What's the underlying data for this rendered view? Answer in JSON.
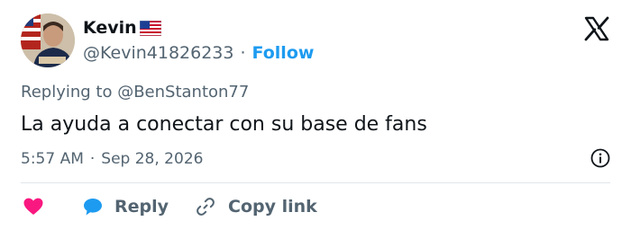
{
  "author": {
    "name": "Kevin",
    "flag_icon": "us-flag-icon",
    "handle": "@Kevin41826233",
    "separator": "·",
    "follow_label": "Follow"
  },
  "reply": {
    "replying_to": "Replying to @BenStanton77"
  },
  "tweet": {
    "text": "La ayuda a conectar con su base de fans",
    "time": "5:57 AM",
    "separator": "·",
    "date": "Sep 28, 2026"
  },
  "actions": {
    "like_icon": "heart-icon",
    "reply_label": "Reply",
    "copy_link_label": "Copy link"
  },
  "colors": {
    "accent": "#1d9bf0",
    "heart": "#f91880",
    "muted": "#536471",
    "text": "#0f1419"
  }
}
